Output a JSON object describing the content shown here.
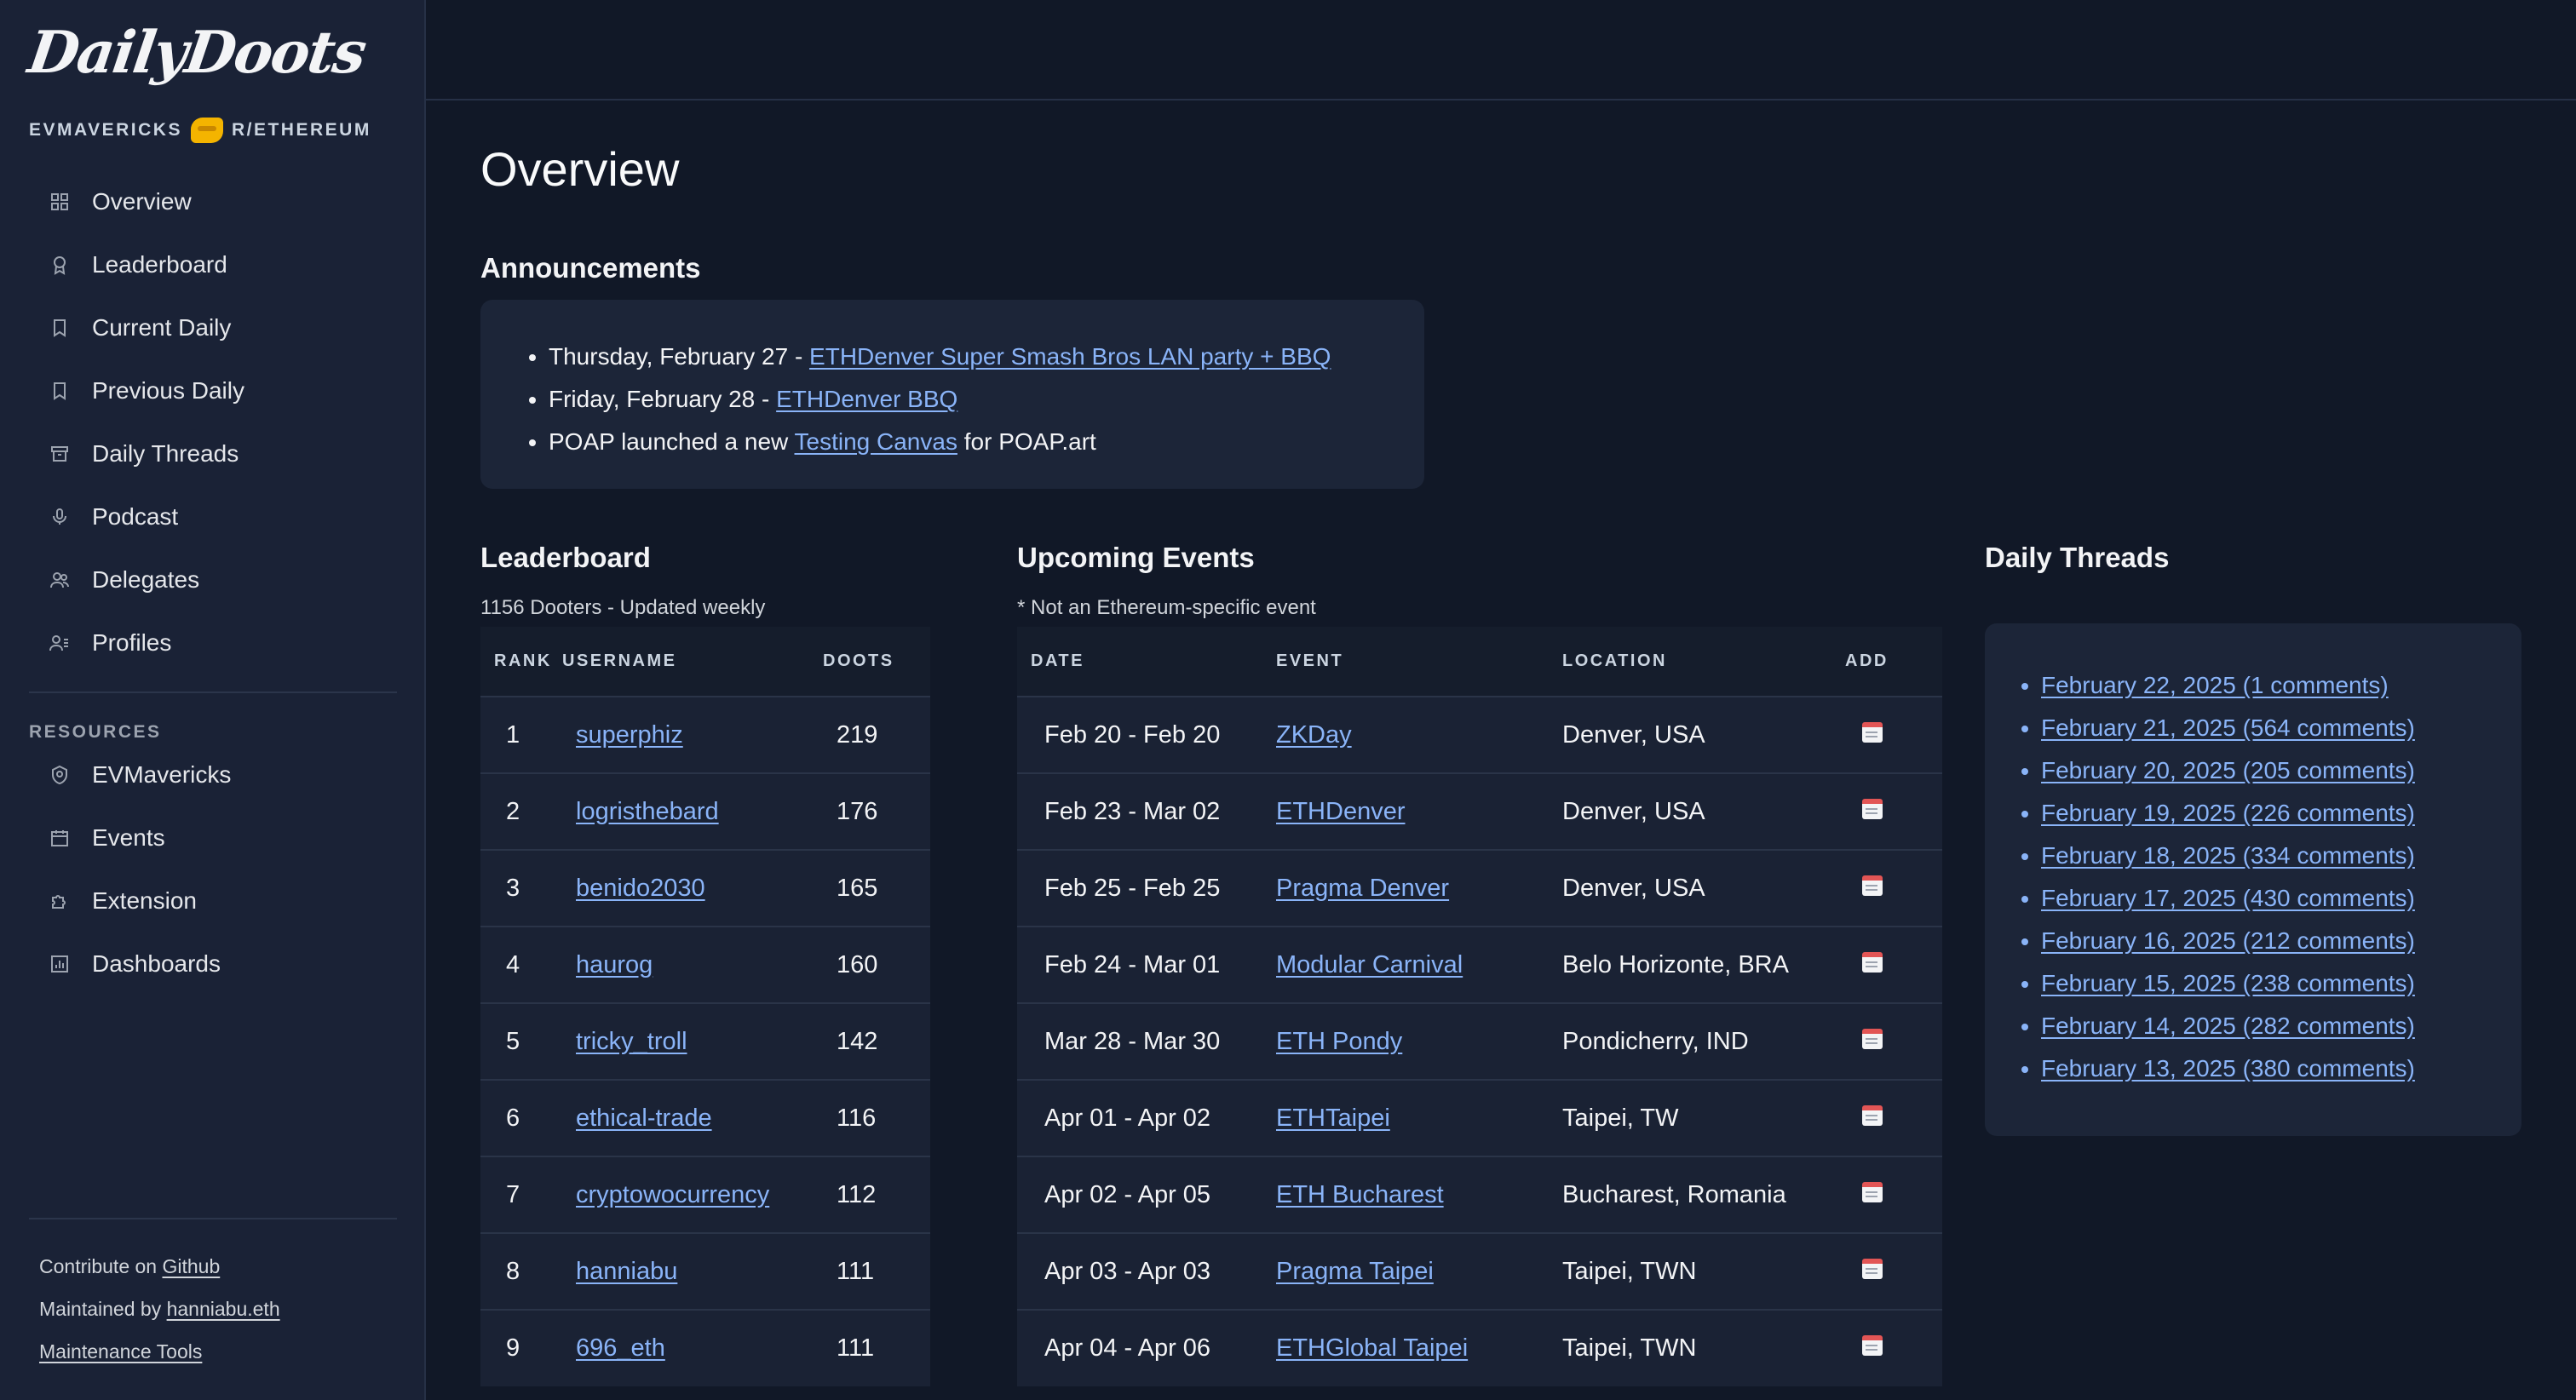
{
  "sidebar": {
    "logo": "DailyDoots",
    "tagline_left": "EVMAVERICKS",
    "tagline_right": "R/ETHEREUM",
    "nav": [
      {
        "label": "Overview",
        "icon": "grid-icon"
      },
      {
        "label": "Leaderboard",
        "icon": "award-icon"
      },
      {
        "label": "Current Daily",
        "icon": "bookmark-icon"
      },
      {
        "label": "Previous Daily",
        "icon": "bookmark-icon"
      },
      {
        "label": "Daily Threads",
        "icon": "archive-icon"
      },
      {
        "label": "Podcast",
        "icon": "microphone-icon"
      },
      {
        "label": "Delegates",
        "icon": "users-icon"
      },
      {
        "label": "Profiles",
        "icon": "user-list-icon"
      }
    ],
    "resources_label": "RESOURCES",
    "resources": [
      {
        "label": "EVMavericks",
        "icon": "shield-icon"
      },
      {
        "label": "Events",
        "icon": "calendar-icon"
      },
      {
        "label": "Extension",
        "icon": "puzzle-icon"
      },
      {
        "label": "Dashboards",
        "icon": "chart-icon"
      }
    ],
    "footer": {
      "contribute_prefix": "Contribute on ",
      "contribute_link": "Github",
      "maintained_prefix": "Maintained by ",
      "maintained_link": "hanniabu.eth",
      "tools_link": "Maintenance Tools"
    }
  },
  "main": {
    "title": "Overview",
    "announcements": {
      "heading": "Announcements",
      "items": [
        {
          "prefix": "Thursday, February 27 - ",
          "link": "ETHDenver Super Smash Bros LAN party + BBQ",
          "suffix": ""
        },
        {
          "prefix": "Friday, February 28 - ",
          "link": "ETHDenver BBQ",
          "suffix": ""
        },
        {
          "prefix": "POAP launched a new ",
          "link": "Testing Canvas",
          "suffix": " for POAP.art"
        }
      ]
    },
    "leaderboard": {
      "heading": "Leaderboard",
      "subtitle": "1156 Dooters - Updated weekly",
      "columns": [
        "RANK",
        "USERNAME",
        "DOOTS"
      ],
      "rows": [
        {
          "rank": "1",
          "username": "superphiz",
          "doots": "219"
        },
        {
          "rank": "2",
          "username": "logristhebard",
          "doots": "176"
        },
        {
          "rank": "3",
          "username": "benido2030",
          "doots": "165"
        },
        {
          "rank": "4",
          "username": "haurog",
          "doots": "160"
        },
        {
          "rank": "5",
          "username": "tricky_troll",
          "doots": "142"
        },
        {
          "rank": "6",
          "username": "ethical-trade",
          "doots": "116"
        },
        {
          "rank": "7",
          "username": "cryptowocurrency",
          "doots": "112"
        },
        {
          "rank": "8",
          "username": "hanniabu",
          "doots": "111"
        },
        {
          "rank": "9",
          "username": "696_eth",
          "doots": "111"
        }
      ]
    },
    "events": {
      "heading": "Upcoming Events",
      "subtitle": "* Not an Ethereum-specific event",
      "columns": [
        "DATE",
        "EVENT",
        "LOCATION",
        "ADD"
      ],
      "rows": [
        {
          "date": "Feb 20 - Feb 20",
          "event": "ZKDay",
          "location": "Denver, USA"
        },
        {
          "date": "Feb 23 - Mar 02",
          "event": "ETHDenver",
          "location": "Denver, USA"
        },
        {
          "date": "Feb 25 - Feb 25",
          "event": "Pragma Denver",
          "location": "Denver, USA"
        },
        {
          "date": "Feb 24 - Mar 01",
          "event": "Modular Carnival",
          "location": "Belo Horizonte, BRA"
        },
        {
          "date": "Mar 28 - Mar 30",
          "event": "ETH Pondy",
          "location": "Pondicherry, IND"
        },
        {
          "date": "Apr 01 - Apr 02",
          "event": "ETHTaipei",
          "location": "Taipei, TW"
        },
        {
          "date": "Apr 02 - Apr 05",
          "event": "ETH Bucharest",
          "location": "Bucharest, Romania"
        },
        {
          "date": "Apr 03 - Apr 03",
          "event": "Pragma Taipei",
          "location": "Taipei, TWN"
        },
        {
          "date": "Apr 04 - Apr 06",
          "event": "ETHGlobal Taipei",
          "location": "Taipei, TWN"
        }
      ]
    },
    "threads": {
      "heading": "Daily Threads",
      "items": [
        "February 22, 2025  (1 comments)",
        "February 21, 2025  (564 comments)",
        "February 20, 2025  (205 comments)",
        "February 19, 2025  (226 comments)",
        "February 18, 2025  (334 comments)",
        "February 17, 2025  (430 comments)",
        "February 16, 2025  (212 comments)",
        "February 15, 2025  (238 comments)",
        "February 14, 2025  (282 comments)",
        "February 13, 2025  (380 comments)"
      ]
    }
  },
  "colors": {
    "background": "#111827",
    "sidebar": "#1a2236",
    "link": "#8ab4f8",
    "card": "#1c2538"
  }
}
